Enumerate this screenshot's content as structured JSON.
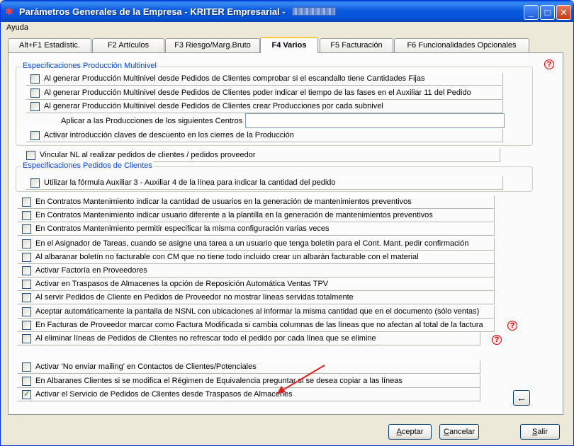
{
  "window": {
    "title": "Parámetros Generales de la Empresa - KRITER Empresarial - ",
    "app_icon": "kriter-app-icon",
    "controls": {
      "minimize": "_",
      "maximize": "□",
      "close": "✕"
    }
  },
  "menu": {
    "items": [
      {
        "label": "Ayuda"
      }
    ]
  },
  "tabs": [
    {
      "label": "Alt+F1 Estadístic.",
      "active": false
    },
    {
      "label": "F2 Artículos",
      "active": false
    },
    {
      "label": "F3 Riesgo/Marg.Bruto",
      "active": false
    },
    {
      "label": "F4 Varios",
      "active": true
    },
    {
      "label": "F5 Facturación",
      "active": false
    },
    {
      "label": "F6 Funcionalidades Opcionales",
      "active": false
    }
  ],
  "groups": {
    "produccion": {
      "title": "Especificaciones Producción Multinivel",
      "options": [
        {
          "label": "Al generar Producción Multinivel desde Pedidos de Clientes comprobar si el escandallo tiene Cantidades Fijas",
          "checked": false
        },
        {
          "label": "Al generar Producción Multinivel desde Pedidos de Clientes poder indicar el tiempo de las fases en el Auxiliar 11 del Pedido",
          "checked": false
        },
        {
          "label": "Al generar Producción Multinivel desde Pedidos de Clientes crear Producciones por cada subnivel",
          "checked": false
        }
      ],
      "centros_label": "Aplicar a las Producciones de los siguientes Centros",
      "centros_value": "",
      "descuento_option": {
        "label": "Activar introducción claves de descuento en los cierres de la Producción",
        "checked": false
      }
    },
    "vincular": {
      "label": "Vincular NL al realizar  pedidos de clientes /  pedidos proveedor",
      "checked": false
    },
    "pedidos": {
      "title": "Especificaciones Pedidos de Clientes",
      "options": [
        {
          "label": "Utilizar la fórmula Auxiliar 3 - Auxiliar 4 de la línea para indicar la cantidad del pedido",
          "checked": false
        }
      ]
    }
  },
  "options_main": [
    {
      "label": "En Contratos Mantenimiento indicar la cantidad de usuarios en la generación de mantenimientos preventivos",
      "checked": false
    },
    {
      "label": "En Contratos Mantenimiento indicar usuario diferente a la plantilla en la generación de mantenimientos preventivos",
      "checked": false
    },
    {
      "label": "En Contratos Mantenimiento permitir especificar la misma configuración varias veces",
      "checked": false
    },
    {
      "label": "En el Asignador de Tareas, cuando se asigne una tarea a un usuario que tenga boletín para el Cont. Mant. pedir confirmación",
      "checked": false
    },
    {
      "label": "Al albaranar boletín no facturable con CM que no tiene todo incluido crear un albarán facturable con el material",
      "checked": false
    },
    {
      "label": "Activar Factoría en Proveedores",
      "checked": false
    },
    {
      "label": "Activar en Traspasos de Almacenes la opción de Reposición Automática Ventas TPV",
      "checked": false
    },
    {
      "label": "Al servir Pedidos de Cliente en Pedidos de Proveedor no mostrar líneas servidas totalmente",
      "checked": false
    },
    {
      "label": "Aceptar automáticamente la pantalla de NSNL con ubicaciones al informar la misma cantidad que en el documento (sólo ventas)",
      "checked": false
    },
    {
      "label": "En Facturas de Proveedor marcar como Factura Modificada si cambia columnas de las líneas que no afectan al total de la factura",
      "checked": false
    },
    {
      "label": "Al eliminar líneas de Pedidos de Clientes no refrescar todo el pedido por cada línea que se elimine",
      "checked": false
    }
  ],
  "options_bottom": [
    {
      "label": "Activar 'No enviar mailing' en Contactos de Clientes/Potenciales",
      "checked": false
    },
    {
      "label": "En Albaranes Clientes si se modifica el Régimen de Equivalencia preguntar si se desea copiar a las líneas",
      "checked": false
    },
    {
      "label": "Activar el Servicio de Pedidos de Clientes desde Traspasos de Almacenes",
      "checked": true
    }
  ],
  "icons": {
    "help": "help-question-icon",
    "back": "←"
  },
  "buttons": {
    "accept": {
      "label": "Aceptar",
      "mnemonic": "A"
    },
    "cancel": {
      "label": "Cancelar",
      "mnemonic": "C"
    },
    "exit": {
      "label": "Salir",
      "mnemonic": "S"
    }
  },
  "colors": {
    "group_title": "#0046d5",
    "active_tab_accent": "#ffc83c",
    "annotation_arrow": "#e0201c",
    "checkbox_check": "#21a121"
  }
}
